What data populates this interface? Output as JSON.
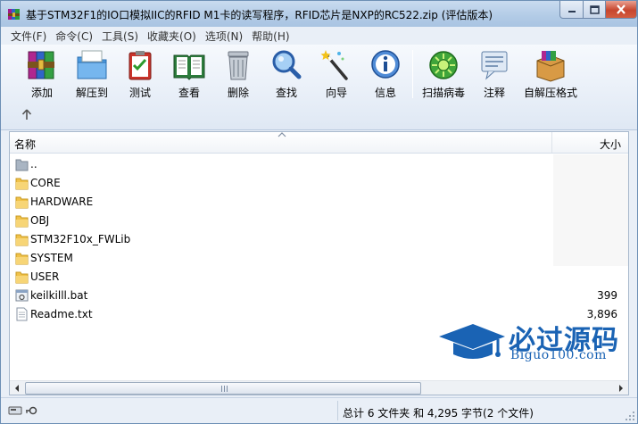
{
  "window": {
    "title": "基于STM32F1的IO口模拟IIC的RFID M1卡的读写程序，RFID芯片是NXP的RC522.zip (评估版本)"
  },
  "menu": [
    {
      "label": "文件(F)"
    },
    {
      "label": "命令(C)"
    },
    {
      "label": "工具(S)"
    },
    {
      "label": "收藏夹(O)"
    },
    {
      "label": "选项(N)"
    },
    {
      "label": "帮助(H)"
    }
  ],
  "toolbar": {
    "buttons": [
      {
        "label": "添加",
        "icon": "archive-books-icon"
      },
      {
        "label": "解压到",
        "icon": "extract-folder-icon"
      },
      {
        "label": "测试",
        "icon": "test-clipboard-icon"
      },
      {
        "label": "查看",
        "icon": "view-book-icon"
      },
      {
        "label": "删除",
        "icon": "trash-can-icon"
      },
      {
        "label": "查找",
        "icon": "magnifier-icon"
      },
      {
        "label": "向导",
        "icon": "wizard-wand-icon"
      },
      {
        "label": "信息",
        "icon": "info-icon"
      },
      {
        "label": "扫描病毒",
        "icon": "virus-scan-icon"
      },
      {
        "label": "注释",
        "icon": "comment-icon"
      },
      {
        "label": "自解压格式",
        "icon": "sfx-box-icon"
      }
    ]
  },
  "list": {
    "columns": {
      "name": "名称",
      "size": "大小"
    },
    "rows": [
      {
        "name": "..",
        "size": "",
        "type": "parent-folder"
      },
      {
        "name": "CORE",
        "size": "",
        "type": "folder"
      },
      {
        "name": "HARDWARE",
        "size": "",
        "type": "folder"
      },
      {
        "name": "OBJ",
        "size": "",
        "type": "folder"
      },
      {
        "name": "STM32F10x_FWLib",
        "size": "",
        "type": "folder"
      },
      {
        "name": "SYSTEM",
        "size": "",
        "type": "folder"
      },
      {
        "name": "USER",
        "size": "",
        "type": "folder"
      },
      {
        "name": "keilkilll.bat",
        "size": "399",
        "type": "bat"
      },
      {
        "name": "Readme.txt",
        "size": "3,896",
        "type": "txt"
      }
    ]
  },
  "status": {
    "text": "总计 6 文件夹 和 4,295 字节(2 个文件)"
  },
  "watermark": {
    "title": "必过源码",
    "subtitle": "Biguo100.com"
  },
  "colors": {
    "title_bg": "#b2cbe6",
    "close_button": "#c7462e",
    "folder": "#f0c24a",
    "watermark": "#1a63b4"
  }
}
